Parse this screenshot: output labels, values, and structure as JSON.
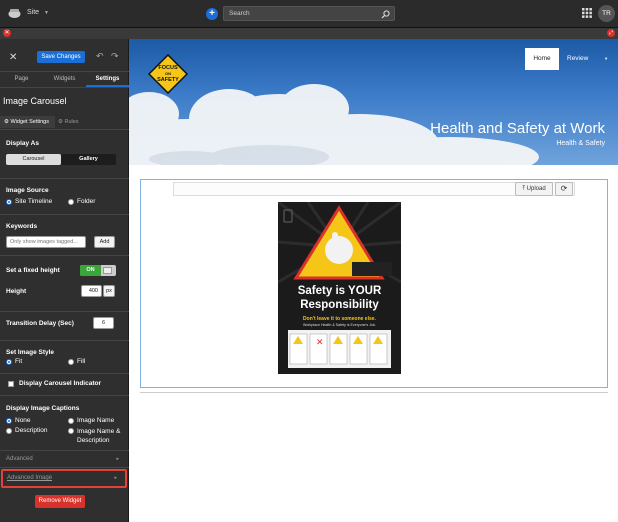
{
  "topbar": {
    "site_label": "Site",
    "search_placeholder": "Search",
    "user_initials": "TR"
  },
  "panel": {
    "save_label": "Save Changes",
    "tabs": [
      "Page",
      "Widgets",
      "Settings"
    ],
    "title": "Image Carousel",
    "subtabs": [
      "Widget Settings",
      "Rules"
    ],
    "display_as": {
      "label": "Display As",
      "options": [
        "Carousel",
        "Gallery"
      ]
    },
    "image_source": {
      "label": "Image Source",
      "options": [
        "Site Timeline",
        "Folder"
      ]
    },
    "keywords": {
      "label": "Keywords",
      "placeholder": "Only show images tagged...",
      "add_label": "Add"
    },
    "fixed_height": {
      "label": "Set a fixed height",
      "toggle_on": "ON"
    },
    "height": {
      "label": "Height",
      "value": "400",
      "unit": "px"
    },
    "transition": {
      "label": "Transition Delay (Sec)",
      "value": "6"
    },
    "image_style": {
      "label": "Set Image Style",
      "options": [
        "Fit",
        "Fill"
      ]
    },
    "indicator_label": "Display Carousel Indicator",
    "captions": {
      "label": "Display Image Captions",
      "options": [
        "None",
        "Image Name",
        "Description",
        "Image Name & Description"
      ]
    },
    "advanced_label": "Advanced",
    "advanced_image_label": "Advanced Image",
    "remove_label": "Remove Widget"
  },
  "site": {
    "nav": [
      "Home",
      "Review"
    ],
    "logo_text": [
      "FOCUS",
      "ON",
      "SAFETY"
    ],
    "hero_title": "Health and Safety at Work",
    "hero_subtitle": "Health & Safety",
    "upload_label": "Upload",
    "poster": {
      "headline_1": "Safety is YOUR",
      "headline_2": "Responsibility",
      "tagline_1": "Don't leave it to someone else.",
      "tagline_2": "Workplace Health & Safety is Everyone's Job."
    }
  },
  "colors": {
    "accent": "#1a6fd6",
    "danger": "#d9322b",
    "highlight": "#e0413a"
  }
}
